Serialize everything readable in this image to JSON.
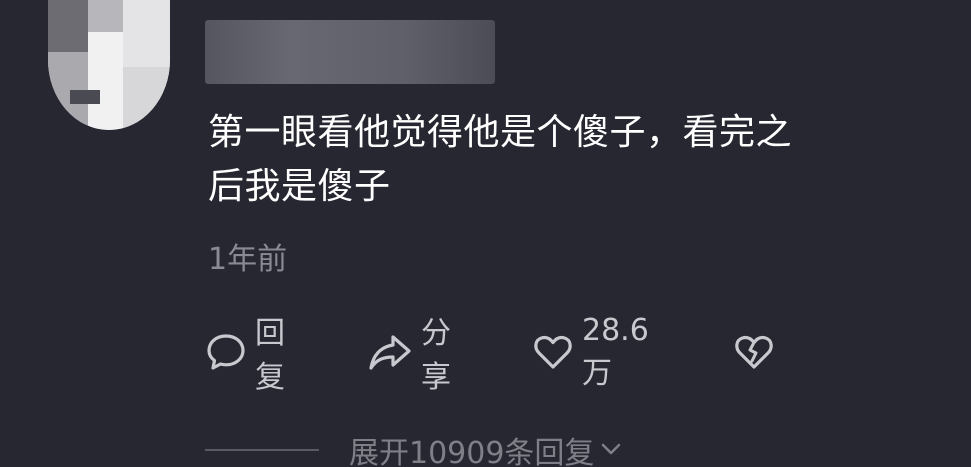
{
  "comment": {
    "text_line1": "第一眼看他觉得他是个傻子，看完之",
    "text_line2": "后我是傻子",
    "time": "1年前"
  },
  "actions": {
    "reply_label": "回复",
    "share_label": "分享",
    "like_count": "28.6万",
    "icons": [
      "comment-icon",
      "share-arrow-icon",
      "heart-icon",
      "broken-heart-icon"
    ]
  },
  "replies": {
    "expand_label": "展开10909条回复"
  },
  "colors": {
    "background": "#272731",
    "text_primary": "#ffffff",
    "text_secondary": "#8a8a93",
    "action_text": "#c8c8cf"
  }
}
